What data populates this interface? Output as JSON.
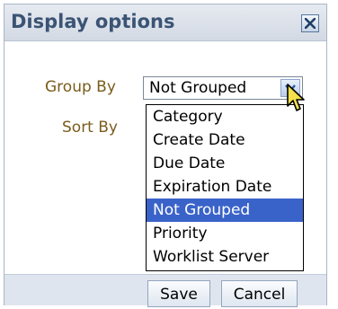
{
  "dialog": {
    "title": "Display options",
    "close_icon": "close-icon"
  },
  "form": {
    "group_by_label": "Group By",
    "group_by_value": "Not Grouped",
    "sort_by_label": "Sort By"
  },
  "dropdown": {
    "options": [
      "Category",
      "Create Date",
      "Due Date",
      "Expiration Date",
      "Not Grouped",
      "Priority",
      "Worklist Server"
    ],
    "selected_index": 4
  },
  "footer": {
    "save_label": "Save",
    "cancel_label": "Cancel"
  },
  "colors": {
    "title_text": "#3b5474",
    "label_text": "#7a5c1c",
    "selection": "#3a63c9",
    "cursor": "#f3e04b"
  }
}
